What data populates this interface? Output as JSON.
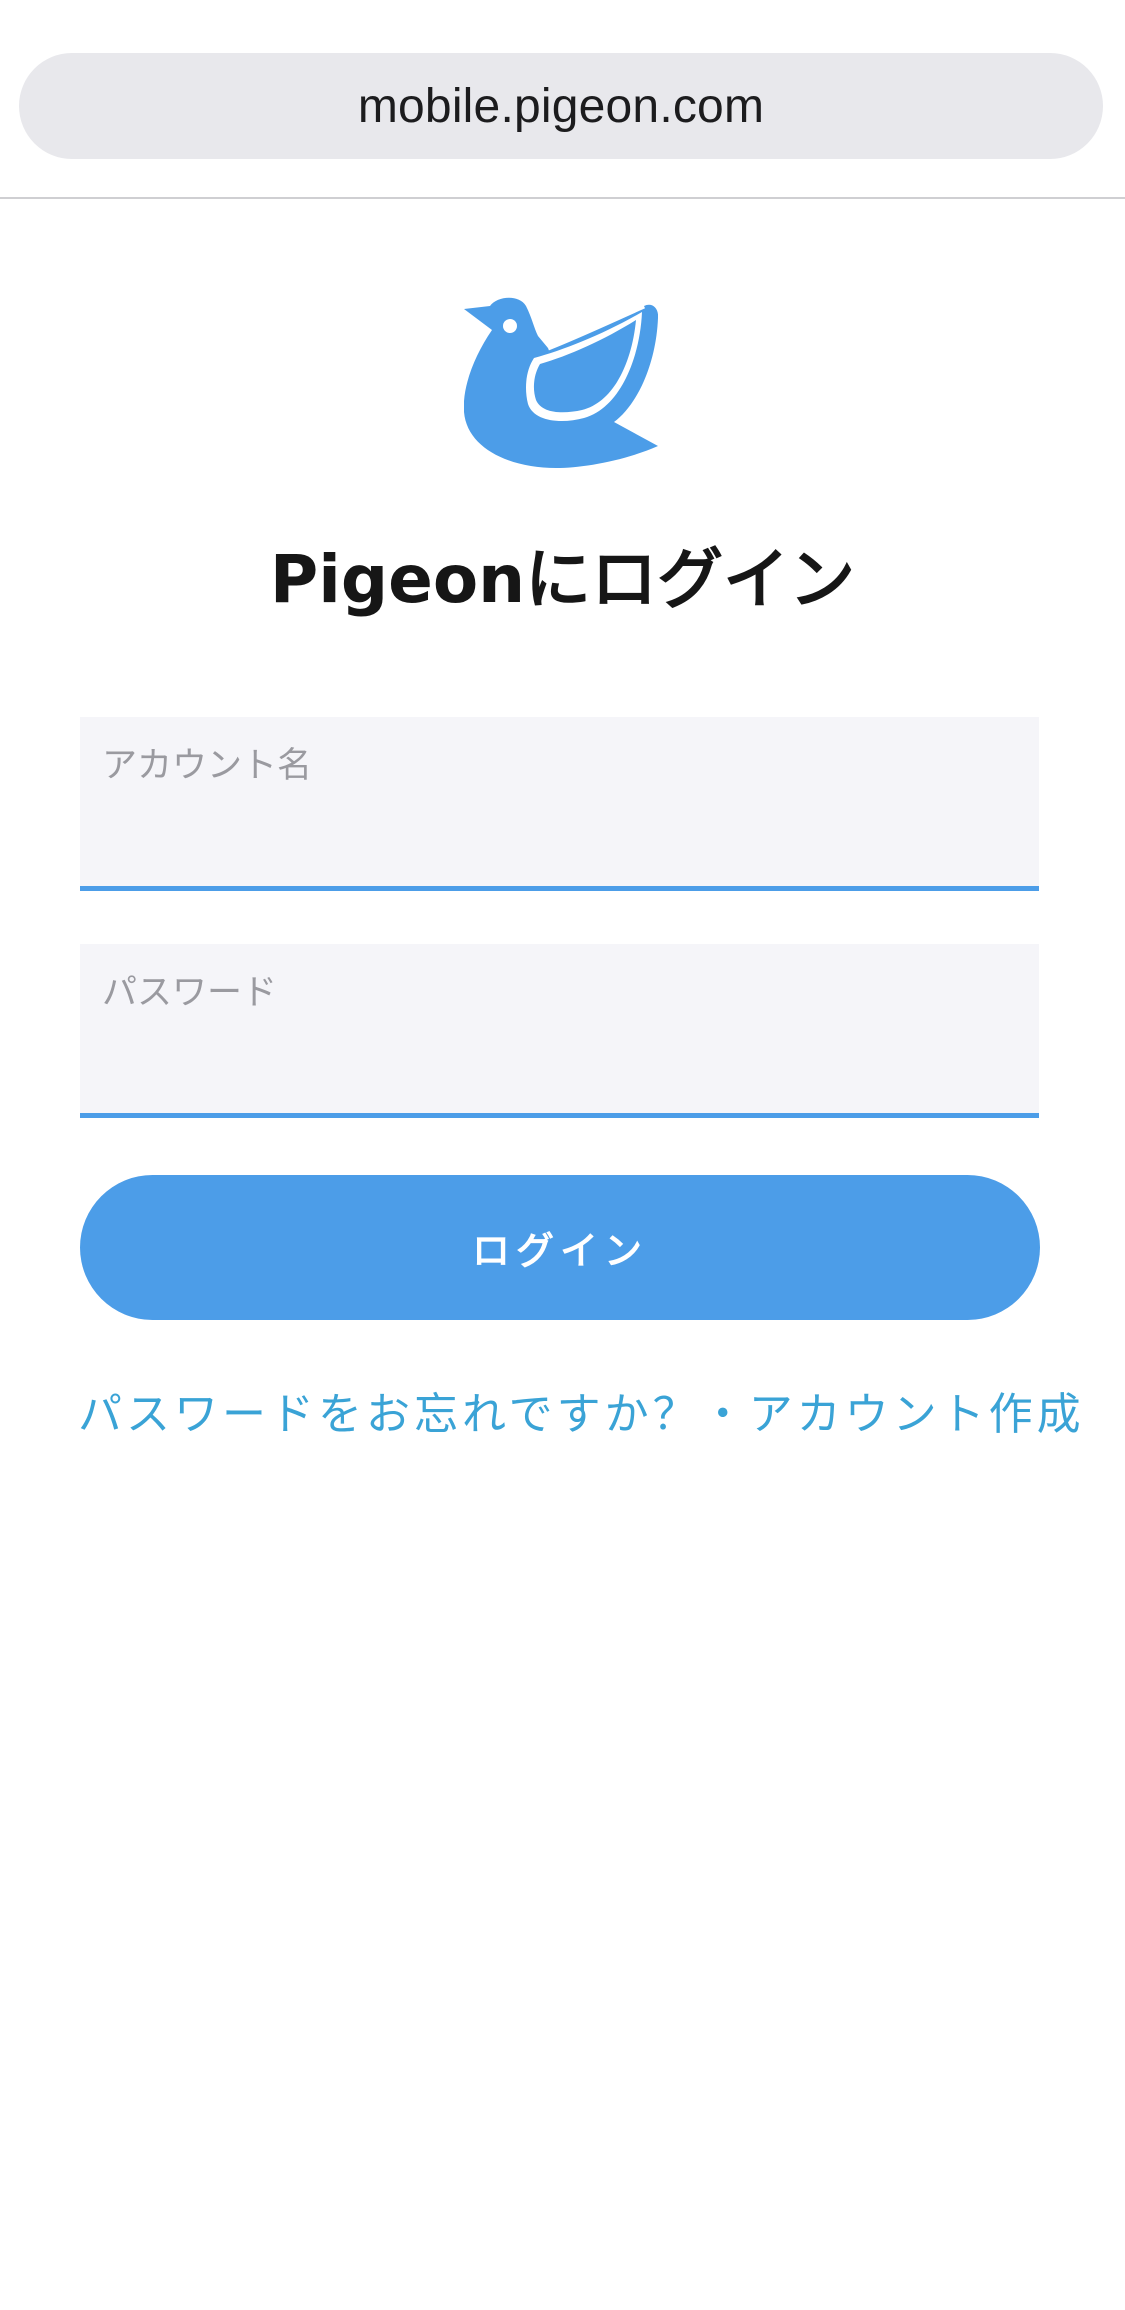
{
  "browser": {
    "url": "mobile.pigeon.com"
  },
  "logo": {
    "icon": "pigeon-bird-icon",
    "color": "#4c9de8"
  },
  "login": {
    "title": "Pigeonにログイン",
    "account_field": {
      "placeholder": "アカウント名",
      "value": ""
    },
    "password_field": {
      "placeholder": "パスワード",
      "value": ""
    },
    "submit_label": "ログイン",
    "forgot_link": "パスワードをお忘れですか？",
    "separator": "・",
    "signup_link": "アカウント作成"
  },
  "colors": {
    "accent": "#4c9de8",
    "link": "#3aa3d6",
    "field_background": "#f5f5f9"
  }
}
